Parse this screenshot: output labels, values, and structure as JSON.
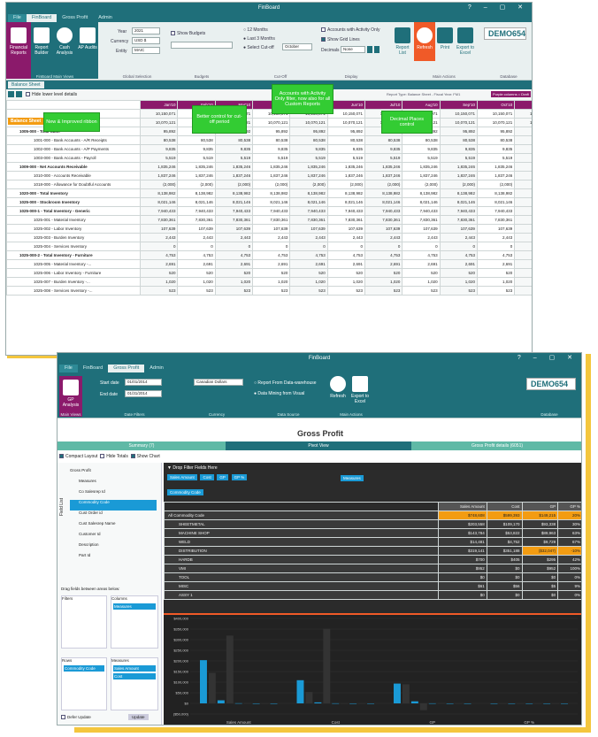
{
  "top_window": {
    "title": "FinBoard",
    "tabs": [
      "File",
      "FinBoard",
      "Gross Profit",
      "Admin"
    ],
    "ribbon": {
      "buttons": [
        "Financial Reports",
        "Report Builder",
        "Cash Analysis",
        "AP Audits"
      ],
      "group_main": "FinBoard Main Views",
      "year_label": "Year",
      "year_value": "2021",
      "currency_label": "Currency",
      "currency_value": "USD $",
      "entity_label": "Entity",
      "entity_value": "MAIC",
      "group_selection": "Global Selection",
      "show_budgets": "Show Budgets",
      "group_budgets": "Budgets",
      "period_12": "12 Months",
      "period_last3": "Last 3 Months",
      "period_cutoff": "Select Cut-off",
      "cutoff_month": "October",
      "group_cutoff": "Cut-Off",
      "accounts_activity": "Accounts with Activity Only",
      "show_grid": "Show Grid Lines",
      "decimal_label": "Decimals",
      "decimal_value": "None",
      "group_display": "Display",
      "report_list": "Report List",
      "refresh": "Refresh",
      "print": "Print",
      "export": "Export to Excel",
      "group_actions": "Main Actions",
      "database": "DEMO654",
      "group_database": "Database"
    },
    "doc_tab": "Balance Sheet",
    "hide_lower": "Hide lower level details",
    "report_type": "Report Type: Balance Sheet - Fiscal Year: FM1",
    "report_badge": "Purple columns = Draft",
    "columns": [
      "Jan'10",
      "Feb'10",
      "Mar'10",
      "Apr'10",
      "May'10",
      "Jun'10",
      "Jul'10",
      "Aug'10",
      "Sep'10",
      "Oct'10",
      "Nov'10",
      "Dec'1"
    ],
    "row_head": "Balance Sheet",
    "rows": [
      {
        "name": "",
        "values": [
          "10,150,071",
          "10,150,071",
          "10,150,071",
          "10,150,071",
          "10,150,071",
          "10,150,071",
          "10,150,071",
          "10,150,071",
          "10,150,071",
          "10,150,071",
          "10,150,071",
          "10,15"
        ]
      },
      {
        "name": "",
        "values": [
          "10,070,121",
          "10,070,121",
          "10,070,121",
          "10,070,121",
          "10,070,121",
          "10,070,121",
          "10,070,121",
          "10,070,121",
          "10,070,121",
          "10,070,121",
          "10,070,121",
          "10,07"
        ]
      },
      {
        "name": "1005-000 - Total Cash",
        "values": [
          "95,892",
          "95,892",
          "95,892",
          "95,892",
          "95,892",
          "95,892",
          "95,892",
          "95,892",
          "95,892",
          "95,892",
          "95,892",
          "9"
        ]
      },
      {
        "name": "1001-000 - Bank Accounts - A/R Receipts",
        "values": [
          "80,538",
          "80,538",
          "80,538",
          "80,538",
          "80,538",
          "80,538",
          "80,538",
          "80,538",
          "80,538",
          "80,538",
          "80,538",
          "8"
        ]
      },
      {
        "name": "1002-000 - Bank Accounts - A/P Payments",
        "values": [
          "9,835",
          "9,835",
          "9,835",
          "9,835",
          "9,835",
          "9,835",
          "9,835",
          "9,835",
          "9,835",
          "9,835",
          "9,835",
          ""
        ]
      },
      {
        "name": "1003-000 - Bank Accounts - Payroll",
        "values": [
          "5,519",
          "5,519",
          "5,519",
          "5,519",
          "5,519",
          "5,519",
          "5,519",
          "5,519",
          "5,519",
          "5,519",
          "5,519",
          ""
        ]
      },
      {
        "name": "1009-000 - Net Accounts Receivable",
        "values": [
          "1,835,246",
          "1,835,246",
          "1,835,246",
          "1,835,246",
          "1,835,246",
          "1,835,246",
          "1,835,246",
          "1,835,246",
          "1,835,246",
          "1,835,246",
          "1,835,246",
          "1,83"
        ]
      },
      {
        "name": "1010-000 - Accounts Receivable",
        "values": [
          "1,837,246",
          "1,837,246",
          "1,837,246",
          "1,837,246",
          "1,837,246",
          "1,837,246",
          "1,837,246",
          "1,837,246",
          "1,837,246",
          "1,837,246",
          "1,837,246",
          "1,83"
        ]
      },
      {
        "name": "1018-000 - Allowance for Doubtful Accounts",
        "values": [
          "(2,000)",
          "(2,000)",
          "(2,000)",
          "(2,000)",
          "(2,000)",
          "(2,000)",
          "(2,000)",
          "(2,000)",
          "(2,000)",
          "(2,000)",
          "(2,000)",
          "("
        ]
      },
      {
        "name": "1020-000 - Total Inventory",
        "values": [
          "8,138,982",
          "8,138,982",
          "8,138,982",
          "8,138,982",
          "8,138,982",
          "8,138,982",
          "8,138,982",
          "8,138,982",
          "8,138,982",
          "8,138,982",
          "8,138,982",
          "8,13"
        ]
      },
      {
        "name": "1025-000 - Stockroom Inventory",
        "values": [
          "8,021,146",
          "8,021,146",
          "8,021,146",
          "8,021,146",
          "8,021,146",
          "8,021,146",
          "8,021,146",
          "8,021,146",
          "8,021,146",
          "8,021,146",
          "8,021,146",
          "8,02"
        ]
      },
      {
        "name": "1025-000-1 - Total Inventory - Generic",
        "values": [
          "7,940,433",
          "7,940,433",
          "7,940,433",
          "7,940,433",
          "7,940,433",
          "7,940,433",
          "7,940,433",
          "7,940,433",
          "7,940,433",
          "7,940,433",
          "7,940,433",
          "7,94"
        ]
      },
      {
        "name": "1025-001 - Material Inventory",
        "values": [
          "7,830,361",
          "7,830,361",
          "7,830,361",
          "7,830,361",
          "7,830,361",
          "7,830,361",
          "7,830,361",
          "7,830,361",
          "7,830,361",
          "7,830,361",
          "7,830,361",
          "7,83"
        ]
      },
      {
        "name": "1025-002 - Labor Inventory",
        "values": [
          "107,639",
          "107,639",
          "107,639",
          "107,639",
          "107,639",
          "107,639",
          "107,639",
          "107,639",
          "107,639",
          "107,639",
          "107,639",
          "10"
        ]
      },
      {
        "name": "1025-003 - Burden Inventory",
        "values": [
          "2,443",
          "2,443",
          "2,443",
          "2,443",
          "2,443",
          "2,443",
          "2,443",
          "2,443",
          "2,443",
          "2,443",
          "2,443",
          ""
        ]
      },
      {
        "name": "1025-004 - Services Inventory",
        "values": [
          "0",
          "0",
          "0",
          "0",
          "0",
          "0",
          "0",
          "0",
          "0",
          "0",
          "0",
          ""
        ]
      },
      {
        "name": "1025-000-2 - Total Inventory - Furniture",
        "values": [
          "4,753",
          "4,753",
          "4,753",
          "4,753",
          "4,753",
          "4,753",
          "4,753",
          "4,753",
          "4,753",
          "4,753",
          "4,753",
          ""
        ]
      },
      {
        "name": "1025-005 - Material Inventory -...",
        "values": [
          "2,691",
          "2,691",
          "2,691",
          "2,691",
          "2,691",
          "2,691",
          "2,691",
          "2,691",
          "2,691",
          "2,691",
          "2,691",
          ""
        ]
      },
      {
        "name": "1025-006 - Labor Inventory - Furniture",
        "values": [
          "520",
          "520",
          "520",
          "520",
          "520",
          "520",
          "520",
          "520",
          "520",
          "520",
          "520",
          ""
        ]
      },
      {
        "name": "1025-007 - Burden Inventory -...",
        "values": [
          "1,020",
          "1,020",
          "1,020",
          "1,020",
          "1,020",
          "1,020",
          "1,020",
          "1,020",
          "1,020",
          "1,020",
          "1,020",
          ""
        ]
      },
      {
        "name": "1025-008 - Services Inventory -...",
        "values": [
          "523",
          "523",
          "523",
          "523",
          "523",
          "523",
          "523",
          "523",
          "523",
          "523",
          "523",
          ""
        ]
      }
    ],
    "callouts": {
      "ribbon": "New & Improved ribbon",
      "cutoff": "Better control for cut-off period",
      "accounts": "Accounts with Activity Only filter, now also for all Custom Reports",
      "decimal": "Decimal Places control"
    }
  },
  "bottom_window": {
    "title": "FinBoard",
    "tabs": [
      "File",
      "FinBoard",
      "Gross Profit",
      "Admin"
    ],
    "ribbon": {
      "gp_button": "GP Analysis",
      "group_main": "Main Views",
      "start_label": "Start date",
      "start_value": "01/01/2014",
      "end_label": "End date",
      "end_value": "01/31/2014",
      "group_dates": "Date Filters",
      "currency_value": "Canadian Dollars",
      "group_currency": "Currency",
      "source_dw": "Report From Data-warehouse",
      "source_visual": "Data Mining from Visual",
      "group_source": "Data Source",
      "refresh": "Refresh",
      "export": "Export to Excel",
      "group_actions": "Main Actions",
      "database": "DEMO654",
      "group_database": "Database"
    },
    "heading": "Gross Profit",
    "pane_tabs": [
      "Summary (7)",
      "Pivot View",
      "Gross Profit details (6051)"
    ],
    "options": [
      "Compact Layout",
      "Hide Totals",
      "Show Chart"
    ],
    "field_list_label": "Field List",
    "field_items": [
      "Gross Profit",
      "Measures",
      "Co Salesrep Id",
      "Commodity Code",
      "Cust Order id",
      "Cust Salesrep Name",
      "Customer Id",
      "Description",
      "Part Id"
    ],
    "drag_hint": "Drag fields between areas below:",
    "filters_label": "Filters",
    "columns_label": "Columns",
    "columns_value": "Measures",
    "rows_label": "Rows",
    "values_label": "Measures",
    "rows_value": "Commodity Code",
    "values_items": [
      "Sales Amount",
      "Cost"
    ],
    "defer_label": "Defer Update",
    "update_label": "Update",
    "drop_filter": "Drop Filter Fields Here",
    "measure_chips": [
      "Sales Amount",
      "Cost",
      "GP",
      "GP %"
    ],
    "measures_label": "Measures",
    "row_field": "Commodity Code",
    "pivot_headers": [
      "Sales Amount",
      "Cost",
      "GP",
      "GP %"
    ],
    "pivot_rows": [
      {
        "name": "All Commodity Code",
        "values": [
          "$748,608",
          "$599,393",
          "$149,215",
          "20%"
        ]
      },
      {
        "name": "SHEETMETAL",
        "values": [
          "$203,558",
          "$109,170",
          "$93,338",
          "30%"
        ]
      },
      {
        "name": "MACHINE SHOP",
        "values": [
          "$143,784",
          "$53,822",
          "$89,963",
          "63%"
        ]
      },
      {
        "name": "WELD",
        "values": [
          "$14,481",
          "$4,752",
          "$9,729",
          "67%"
        ]
      },
      {
        "name": "DISTRIBUTION",
        "values": [
          "$319,141",
          "$351,188",
          "($32,047)",
          "-10%"
        ]
      },
      {
        "name": "HARDB",
        "values": [
          "$700",
          "$405",
          "$295",
          "42%"
        ]
      },
      {
        "name": "VMI",
        "values": [
          "$952",
          "$0",
          "$952",
          "100%"
        ]
      },
      {
        "name": "TOOL",
        "values": [
          "$0",
          "$0",
          "$0",
          "0%"
        ]
      },
      {
        "name": "MISC",
        "values": [
          "$61",
          "$56",
          "$5",
          "9%"
        ]
      },
      {
        "name": "ASSY 1",
        "values": [
          "$0",
          "$0",
          "$0",
          "0%"
        ]
      }
    ],
    "chart_data": {
      "type": "bar",
      "categories": [
        "Sales Amount",
        "Cost",
        "GP",
        "GP %"
      ],
      "ylim": [
        0,
        400000
      ],
      "ytick_labels": [
        "$400,000",
        "$350,000",
        "$300,000",
        "$250,000",
        "$200,000",
        "$150,000",
        "$100,000",
        "$50,000",
        "$0",
        "($50,000)"
      ],
      "groups": [
        {
          "category": "Sales Amount",
          "values": [
            203558,
            143784,
            14481,
            319141,
            700,
            952,
            0,
            61,
            0
          ]
        },
        {
          "category": "Cost",
          "values": [
            109170,
            53822,
            4752,
            351188,
            405,
            0,
            0,
            56,
            0
          ]
        },
        {
          "category": "GP",
          "values": [
            93338,
            89963,
            9729,
            -32047,
            295,
            952,
            0,
            5,
            0
          ]
        },
        {
          "category": "GP %",
          "values": [
            0,
            0,
            0,
            0,
            0,
            0,
            0,
            0,
            0
          ]
        }
      ],
      "colors": {
        "bar": "#1a9ad6",
        "dark": "#333333"
      }
    }
  },
  "colors": {
    "teal": "#1f6f7a",
    "yellow": "#f4c63d",
    "purple": "#8b1a6b",
    "green": "#33cc33",
    "orange": "#f39c12"
  }
}
